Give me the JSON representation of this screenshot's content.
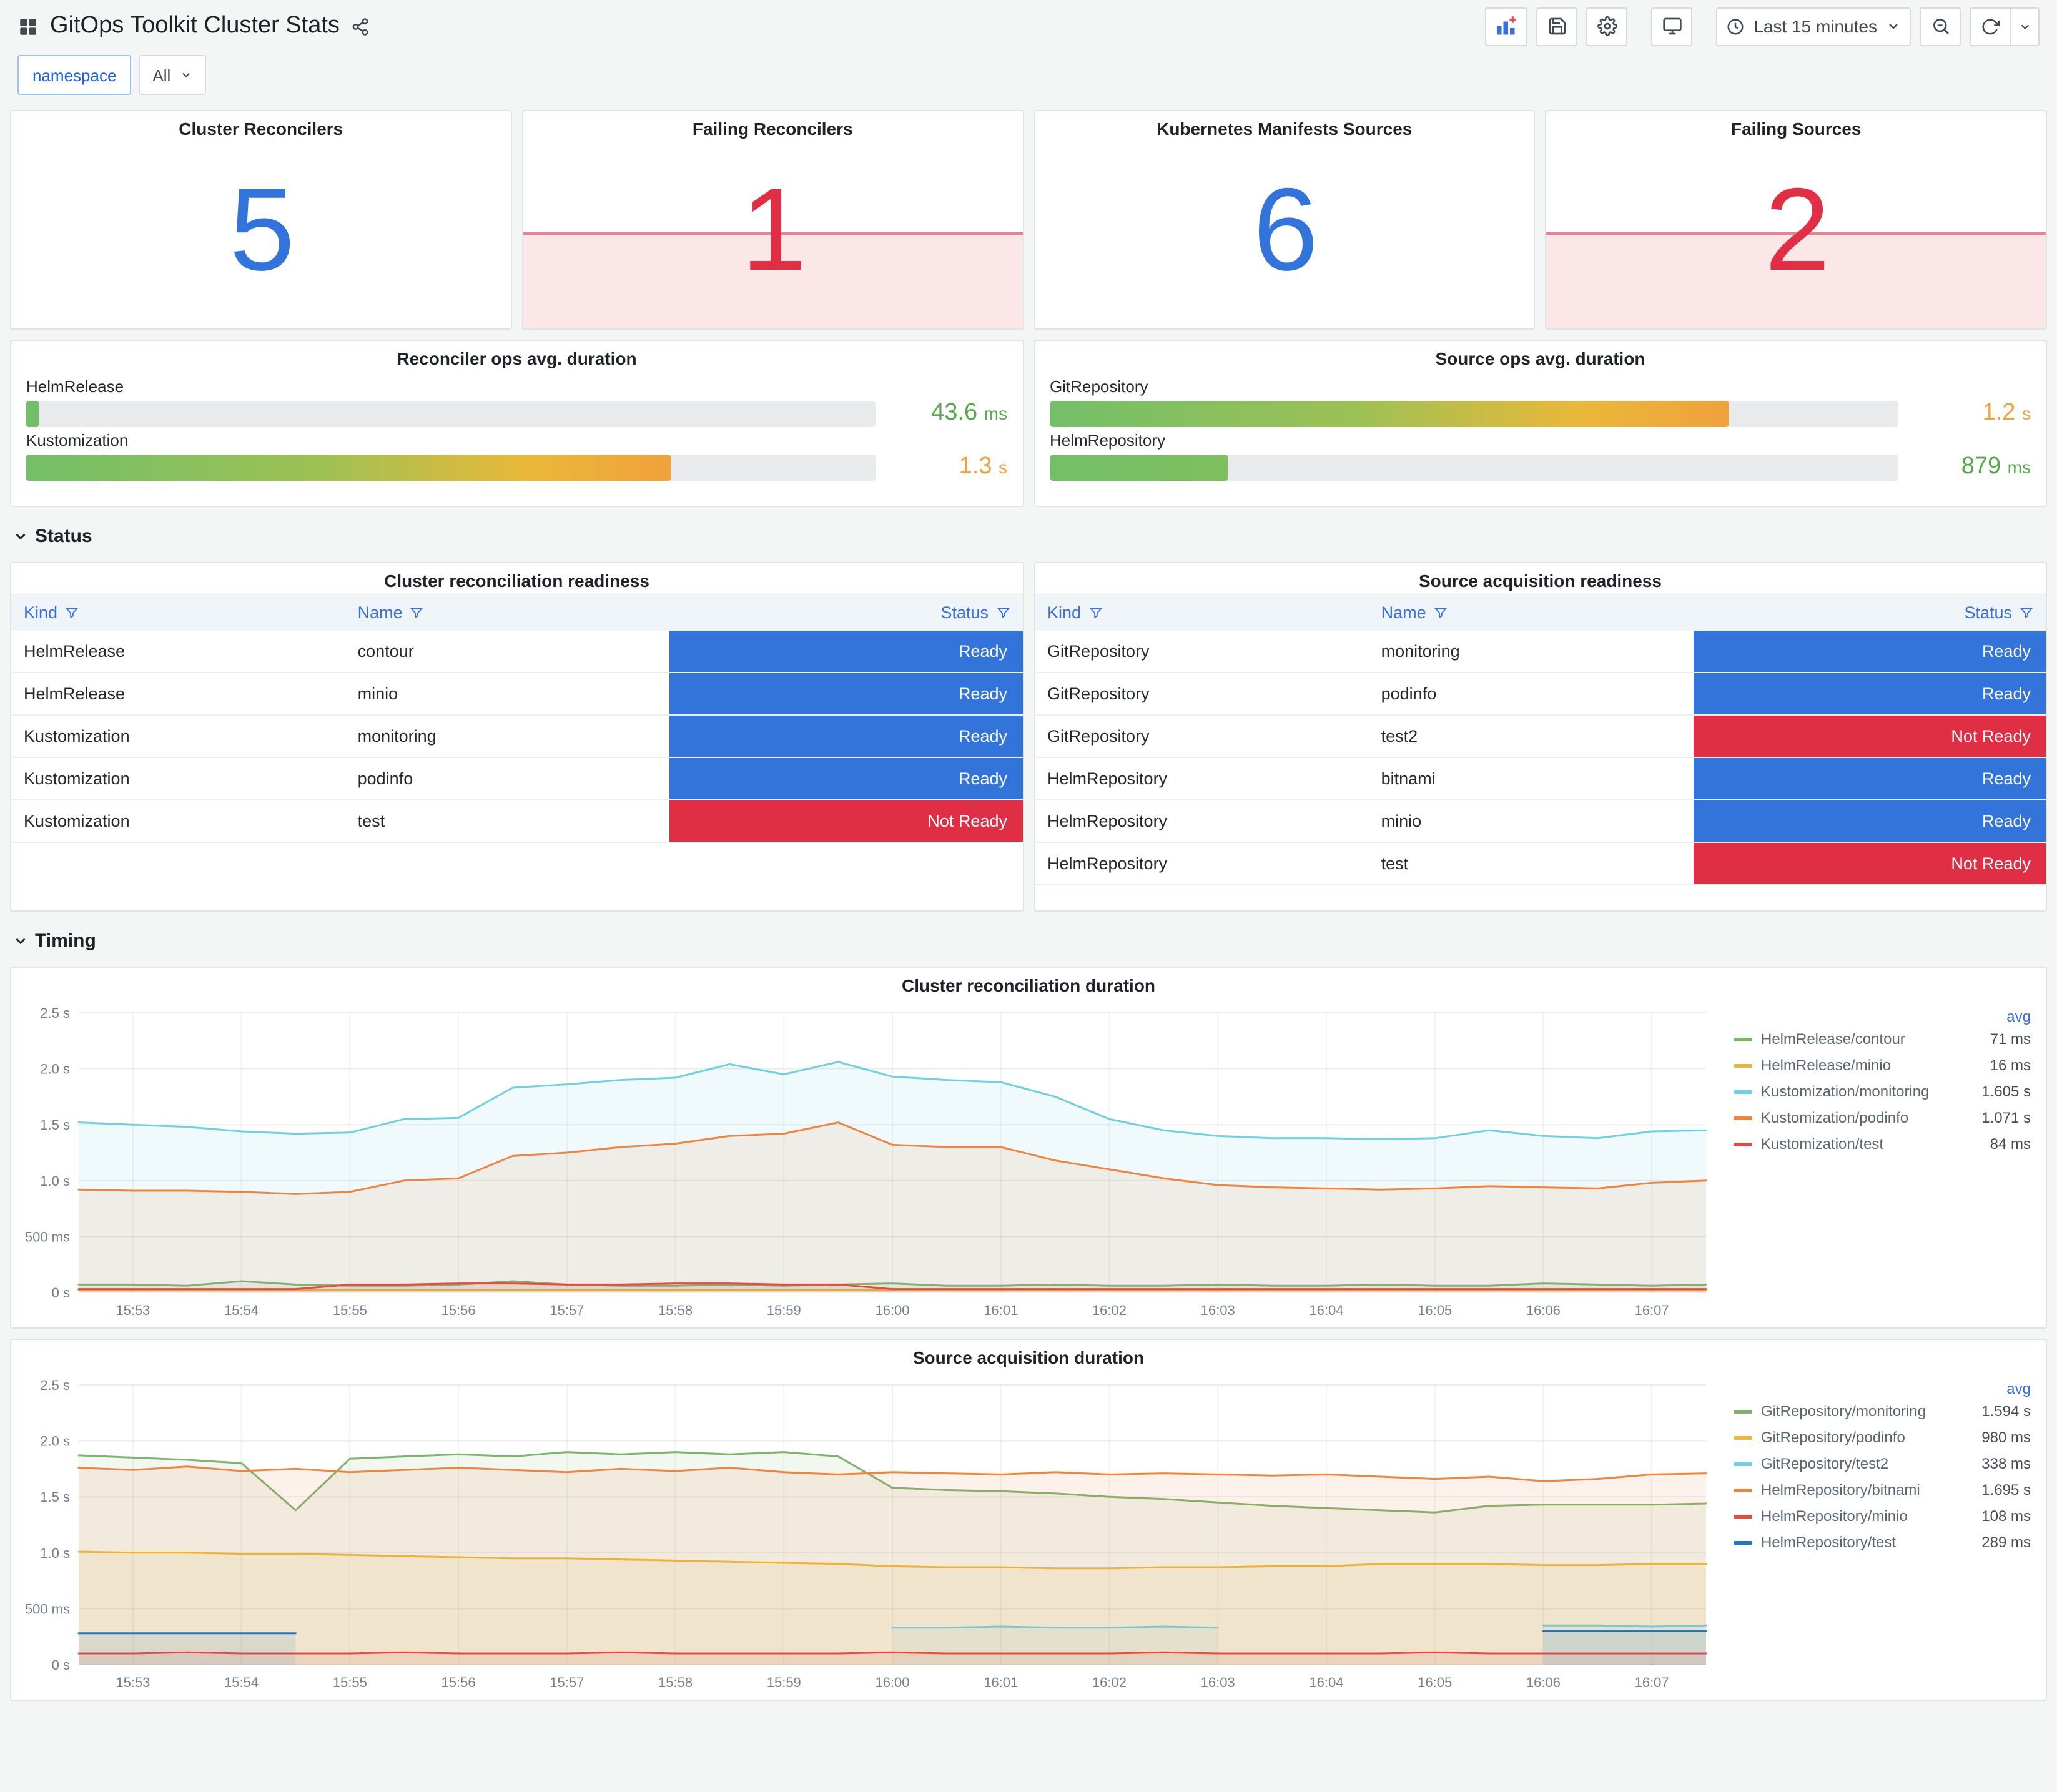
{
  "header": {
    "title": "GitOps Toolkit Cluster Stats",
    "time_range": "Last 15 minutes"
  },
  "filters": {
    "name_label": "namespace",
    "value": "All"
  },
  "sections": {
    "status": "Status",
    "timing": "Timing"
  },
  "stats": [
    {
      "title": "Cluster Reconcilers",
      "value": "5",
      "color": "#3274D9",
      "alert": false
    },
    {
      "title": "Failing Reconcilers",
      "value": "1",
      "color": "#E02F44",
      "alert": true
    },
    {
      "title": "Kubernetes Manifests Sources",
      "value": "6",
      "color": "#3274D9",
      "alert": false
    },
    {
      "title": "Failing Sources",
      "value": "2",
      "color": "#E02F44",
      "alert": true
    }
  ],
  "gauges": [
    {
      "title": "Reconciler ops avg. duration",
      "rows": [
        {
          "label": "HelmRelease",
          "value": "43.6",
          "unit": "ms",
          "pct": 1.4,
          "value_color": "#56A64B",
          "bar_gradient": [
            "#73BF69"
          ]
        },
        {
          "label": "Kustomization",
          "value": "1.3",
          "unit": "s",
          "pct": 76,
          "value_color": "#EBA13C",
          "bar_gradient": [
            "#73BF69",
            "#9DC154 45%",
            "#EAB839 78%",
            "#F0A13C"
          ]
        }
      ]
    },
    {
      "title": "Source ops avg. duration",
      "rows": [
        {
          "label": "GitRepository",
          "value": "1.2",
          "unit": "s",
          "pct": 80,
          "value_color": "#EBA13C",
          "bar_gradient": [
            "#73BF69",
            "#9DC154 45%",
            "#EAB839 78%",
            "#F0A13C"
          ]
        },
        {
          "label": "HelmRepository",
          "value": "879",
          "unit": "ms",
          "pct": 21,
          "value_color": "#56A64B",
          "bar_gradient": [
            "#73BF69",
            "#7FBF5F"
          ]
        }
      ]
    }
  ],
  "status_colors": {
    "Ready": "#3274D9",
    "Not Ready": "#E02F44"
  },
  "tables": [
    {
      "title": "Cluster reconciliation readiness",
      "columns": [
        "Kind",
        "Name",
        "Status"
      ],
      "rows": [
        [
          "HelmRelease",
          "contour",
          "Ready"
        ],
        [
          "HelmRelease",
          "minio",
          "Ready"
        ],
        [
          "Kustomization",
          "monitoring",
          "Ready"
        ],
        [
          "Kustomization",
          "podinfo",
          "Ready"
        ],
        [
          "Kustomization",
          "test",
          "Not Ready"
        ]
      ]
    },
    {
      "title": "Source acquisition readiness",
      "columns": [
        "Kind",
        "Name",
        "Status"
      ],
      "rows": [
        [
          "GitRepository",
          "monitoring",
          "Ready"
        ],
        [
          "GitRepository",
          "podinfo",
          "Ready"
        ],
        [
          "GitRepository",
          "test2",
          "Not Ready"
        ],
        [
          "HelmRepository",
          "bitnami",
          "Ready"
        ],
        [
          "HelmRepository",
          "minio",
          "Ready"
        ],
        [
          "HelmRepository",
          "test",
          "Not Ready"
        ]
      ]
    }
  ],
  "chart_data": [
    {
      "type": "line",
      "title": "Cluster reconciliation duration",
      "ylim": [
        0,
        2.5
      ],
      "y_ticks": [
        "0 s",
        "500 ms",
        "1.0 s",
        "1.5 s",
        "2.0 s",
        "2.5 s"
      ],
      "x_ticks": [
        "15:53",
        "15:54",
        "15:55",
        "15:56",
        "15:57",
        "15:58",
        "15:59",
        "16:00",
        "16:01",
        "16:02",
        "16:03",
        "16:04",
        "16:05",
        "16:06",
        "16:07"
      ],
      "x_step": 0.5,
      "x_tick_start": 0.5,
      "x_tick_step": 1,
      "legend_header": "avg",
      "legend_position": "right",
      "grid": true,
      "series": [
        {
          "name": "HelmRelease/contour",
          "avg": "71 ms",
          "color": "#7EB26D",
          "values": [
            0.07,
            0.07,
            0.06,
            0.1,
            0.07,
            0.06,
            0.06,
            0.07,
            0.1,
            0.07,
            0.06,
            0.06,
            0.07,
            0.06,
            0.07,
            0.08,
            0.06,
            0.06,
            0.07,
            0.06,
            0.06,
            0.07,
            0.06,
            0.06,
            0.07,
            0.06,
            0.06,
            0.08,
            0.07,
            0.06,
            0.07
          ]
        },
        {
          "name": "HelmRelease/minio",
          "avg": "16 ms",
          "color": "#EAB839",
          "values": [
            0.02,
            0.02,
            0.02,
            0.02,
            0.02,
            0.02,
            0.02,
            0.02,
            0.02,
            0.02,
            0.02,
            0.02,
            0.02,
            0.02,
            0.02,
            0.02,
            0.02,
            0.02,
            0.02,
            0.02,
            0.02,
            0.02,
            0.02,
            0.02,
            0.02,
            0.02,
            0.02,
            0.02,
            0.02,
            0.02,
            0.02
          ]
        },
        {
          "name": "Kustomization/monitoring",
          "avg": "1.605 s",
          "color": "#6ED0E0",
          "values": [
            1.52,
            1.5,
            1.48,
            1.44,
            1.42,
            1.43,
            1.55,
            1.56,
            1.83,
            1.86,
            1.9,
            1.92,
            2.04,
            1.95,
            2.06,
            1.93,
            1.9,
            1.88,
            1.75,
            1.55,
            1.45,
            1.4,
            1.38,
            1.38,
            1.37,
            1.38,
            1.45,
            1.4,
            1.38,
            1.44,
            1.45
          ]
        },
        {
          "name": "Kustomization/podinfo",
          "avg": "1.071 s",
          "color": "#EF843C",
          "values": [
            0.92,
            0.91,
            0.91,
            0.9,
            0.88,
            0.9,
            1.0,
            1.02,
            1.22,
            1.25,
            1.3,
            1.33,
            1.4,
            1.42,
            1.52,
            1.32,
            1.3,
            1.3,
            1.18,
            1.1,
            1.02,
            0.96,
            0.94,
            0.93,
            0.92,
            0.93,
            0.95,
            0.94,
            0.93,
            0.98,
            1.0
          ]
        },
        {
          "name": "Kustomization/test",
          "avg": "84 ms",
          "color": "#E24D42",
          "values": [
            0.03,
            0.03,
            0.03,
            0.03,
            0.03,
            0.07,
            0.07,
            0.08,
            0.08,
            0.07,
            0.07,
            0.08,
            0.08,
            0.07,
            0.07,
            0.03,
            0.03,
            0.03,
            0.03,
            0.03,
            0.03,
            0.03,
            0.03,
            0.03,
            0.03,
            0.03,
            0.03,
            0.03,
            0.03,
            0.03,
            0.03
          ]
        }
      ]
    },
    {
      "type": "line",
      "title": "Source acquisition duration",
      "ylim": [
        0,
        2.5
      ],
      "y_ticks": [
        "0 s",
        "500 ms",
        "1.0 s",
        "1.5 s",
        "2.0 s",
        "2.5 s"
      ],
      "x_ticks": [
        "15:53",
        "15:54",
        "15:55",
        "15:56",
        "15:57",
        "15:58",
        "15:59",
        "16:00",
        "16:01",
        "16:02",
        "16:03",
        "16:04",
        "16:05",
        "16:06",
        "16:07"
      ],
      "x_step": 0.5,
      "x_tick_start": 0.5,
      "x_tick_step": 1,
      "legend_header": "avg",
      "legend_position": "right",
      "grid": true,
      "series": [
        {
          "name": "GitRepository/monitoring",
          "avg": "1.594 s",
          "color": "#7EB26D",
          "values": [
            1.87,
            1.85,
            1.83,
            1.8,
            1.38,
            1.84,
            1.86,
            1.88,
            1.86,
            1.9,
            1.88,
            1.9,
            1.88,
            1.9,
            1.86,
            1.58,
            1.56,
            1.55,
            1.53,
            1.5,
            1.48,
            1.45,
            1.42,
            1.4,
            1.38,
            1.36,
            1.42,
            1.43,
            1.43,
            1.43,
            1.44
          ]
        },
        {
          "name": "GitRepository/podinfo",
          "avg": "980 ms",
          "color": "#EAB839",
          "values": [
            1.01,
            1.0,
            1.0,
            0.99,
            0.99,
            0.98,
            0.97,
            0.96,
            0.95,
            0.95,
            0.94,
            0.93,
            0.92,
            0.91,
            0.9,
            0.88,
            0.87,
            0.87,
            0.86,
            0.86,
            0.87,
            0.87,
            0.88,
            0.88,
            0.9,
            0.9,
            0.9,
            0.89,
            0.89,
            0.9,
            0.9
          ]
        },
        {
          "name": "GitRepository/test2",
          "avg": "338 ms",
          "color": "#6ED0E0",
          "values": [
            null,
            null,
            null,
            null,
            null,
            null,
            null,
            null,
            null,
            null,
            null,
            null,
            null,
            null,
            null,
            0.33,
            0.33,
            0.34,
            0.33,
            0.33,
            0.34,
            0.33,
            null,
            null,
            null,
            null,
            null,
            0.35,
            0.35,
            0.34,
            0.35
          ]
        },
        {
          "name": "HelmRepository/bitnami",
          "avg": "1.695 s",
          "color": "#EF843C",
          "values": [
            1.76,
            1.74,
            1.77,
            1.73,
            1.75,
            1.72,
            1.74,
            1.76,
            1.74,
            1.72,
            1.75,
            1.73,
            1.76,
            1.72,
            1.7,
            1.72,
            1.71,
            1.7,
            1.72,
            1.7,
            1.71,
            1.7,
            1.69,
            1.7,
            1.68,
            1.66,
            1.68,
            1.64,
            1.66,
            1.7,
            1.71
          ]
        },
        {
          "name": "HelmRepository/minio",
          "avg": "108 ms",
          "color": "#E24D42",
          "values": [
            0.1,
            0.1,
            0.11,
            0.1,
            0.1,
            0.1,
            0.11,
            0.1,
            0.1,
            0.1,
            0.11,
            0.1,
            0.1,
            0.1,
            0.1,
            0.11,
            0.1,
            0.1,
            0.1,
            0.1,
            0.11,
            0.1,
            0.1,
            0.1,
            0.1,
            0.11,
            0.1,
            0.1,
            0.1,
            0.1,
            0.1
          ]
        },
        {
          "name": "HelmRepository/test",
          "avg": "289 ms",
          "color": "#1F78C1",
          "values": [
            0.28,
            0.28,
            0.28,
            0.28,
            0.28,
            null,
            null,
            null,
            null,
            null,
            null,
            null,
            null,
            null,
            null,
            null,
            null,
            null,
            null,
            null,
            null,
            null,
            null,
            null,
            null,
            null,
            null,
            0.3,
            0.3,
            0.3,
            0.3
          ]
        }
      ]
    }
  ]
}
